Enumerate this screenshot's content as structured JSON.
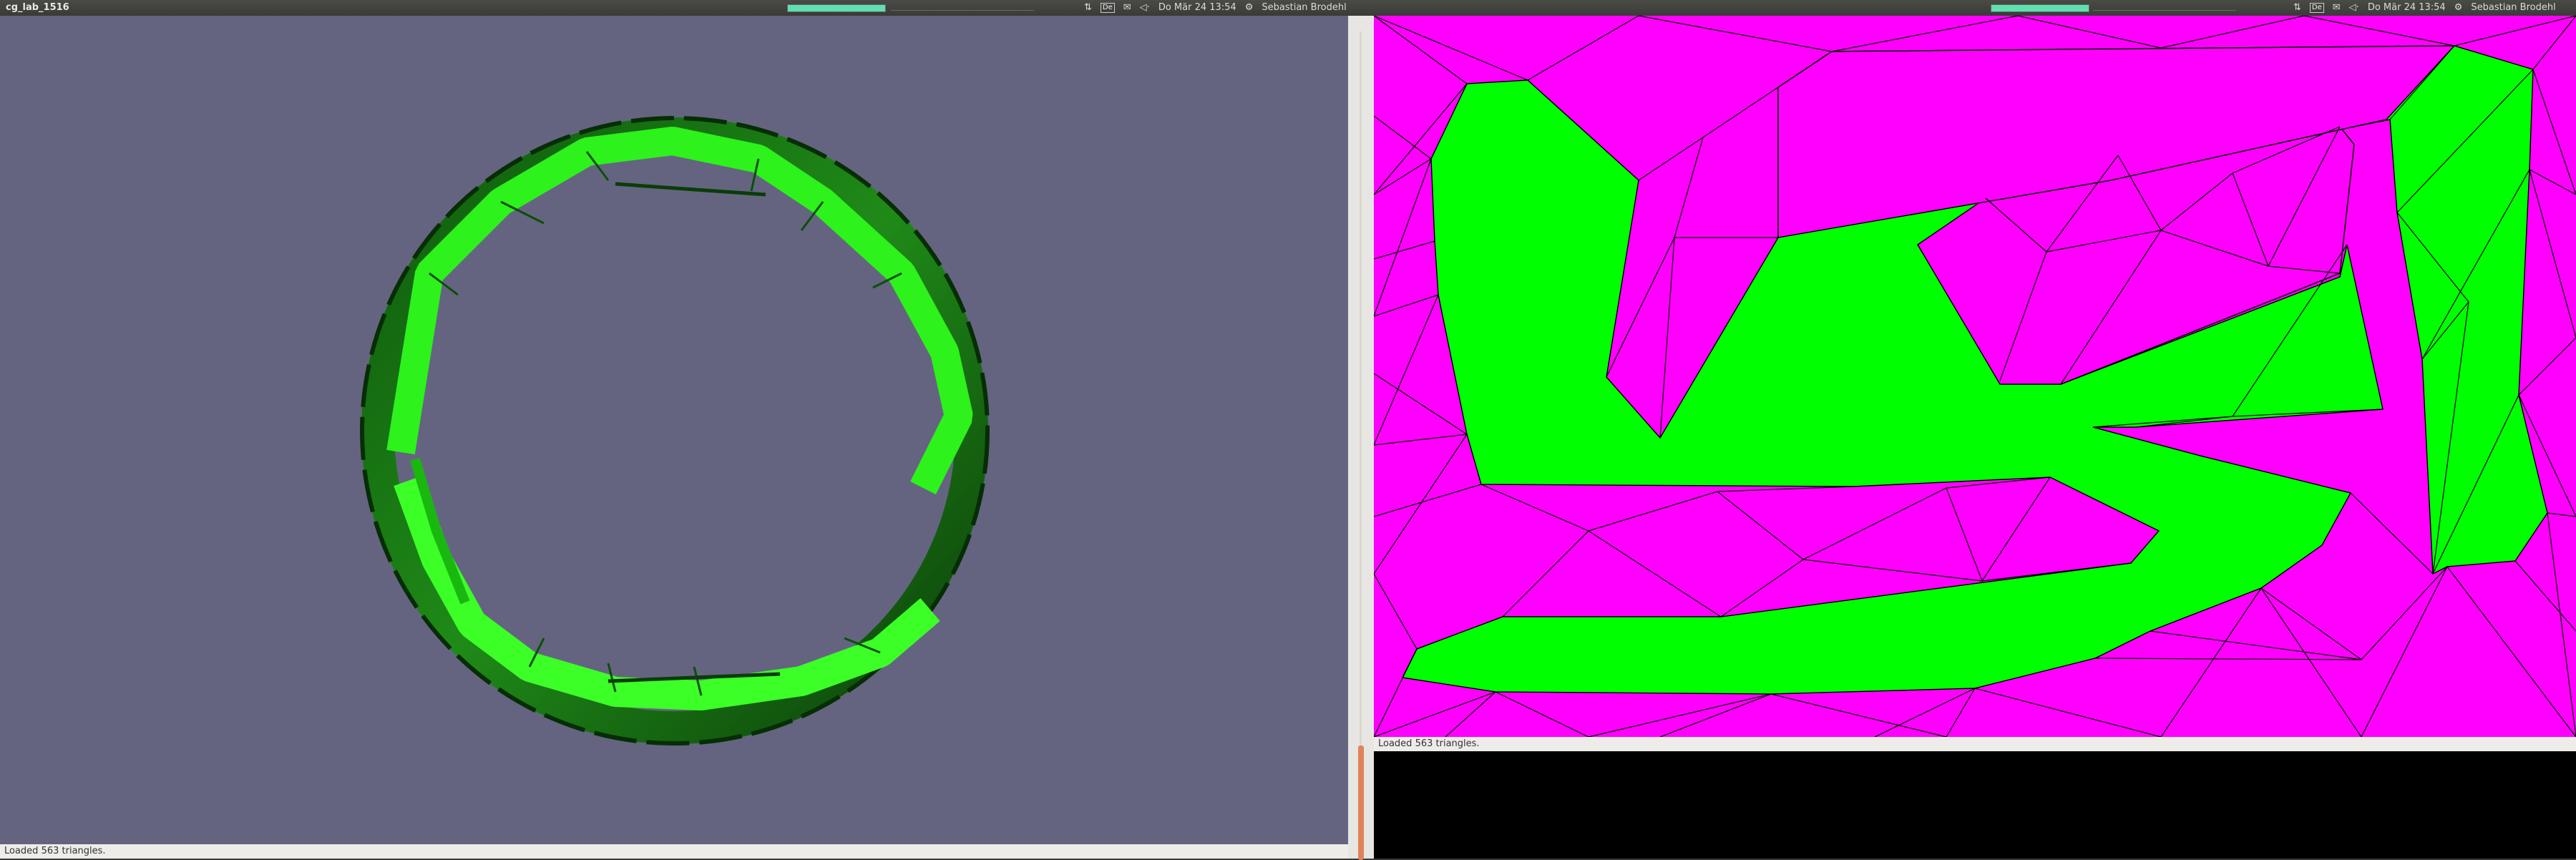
{
  "left_window": {
    "title": "cg_lab_1516",
    "indicators": {
      "keyboard": "De",
      "clock": "Do Mär 24 13:54",
      "user": "Sebastian Brodehl"
    },
    "status_text": "Loaded 563 triangles.",
    "viewport_background": "#646480",
    "mesh_color": "#27ee19"
  },
  "right_window": {
    "indicators": {
      "keyboard": "De",
      "clock": "Do Mär 24 13:54",
      "user": "Sebastian Brodehl"
    },
    "status_text": "Loaded 563 triangles.",
    "fill_colors": {
      "inside": "#00ff00",
      "outside": "#ff00ff",
      "edges": "#000000"
    }
  }
}
